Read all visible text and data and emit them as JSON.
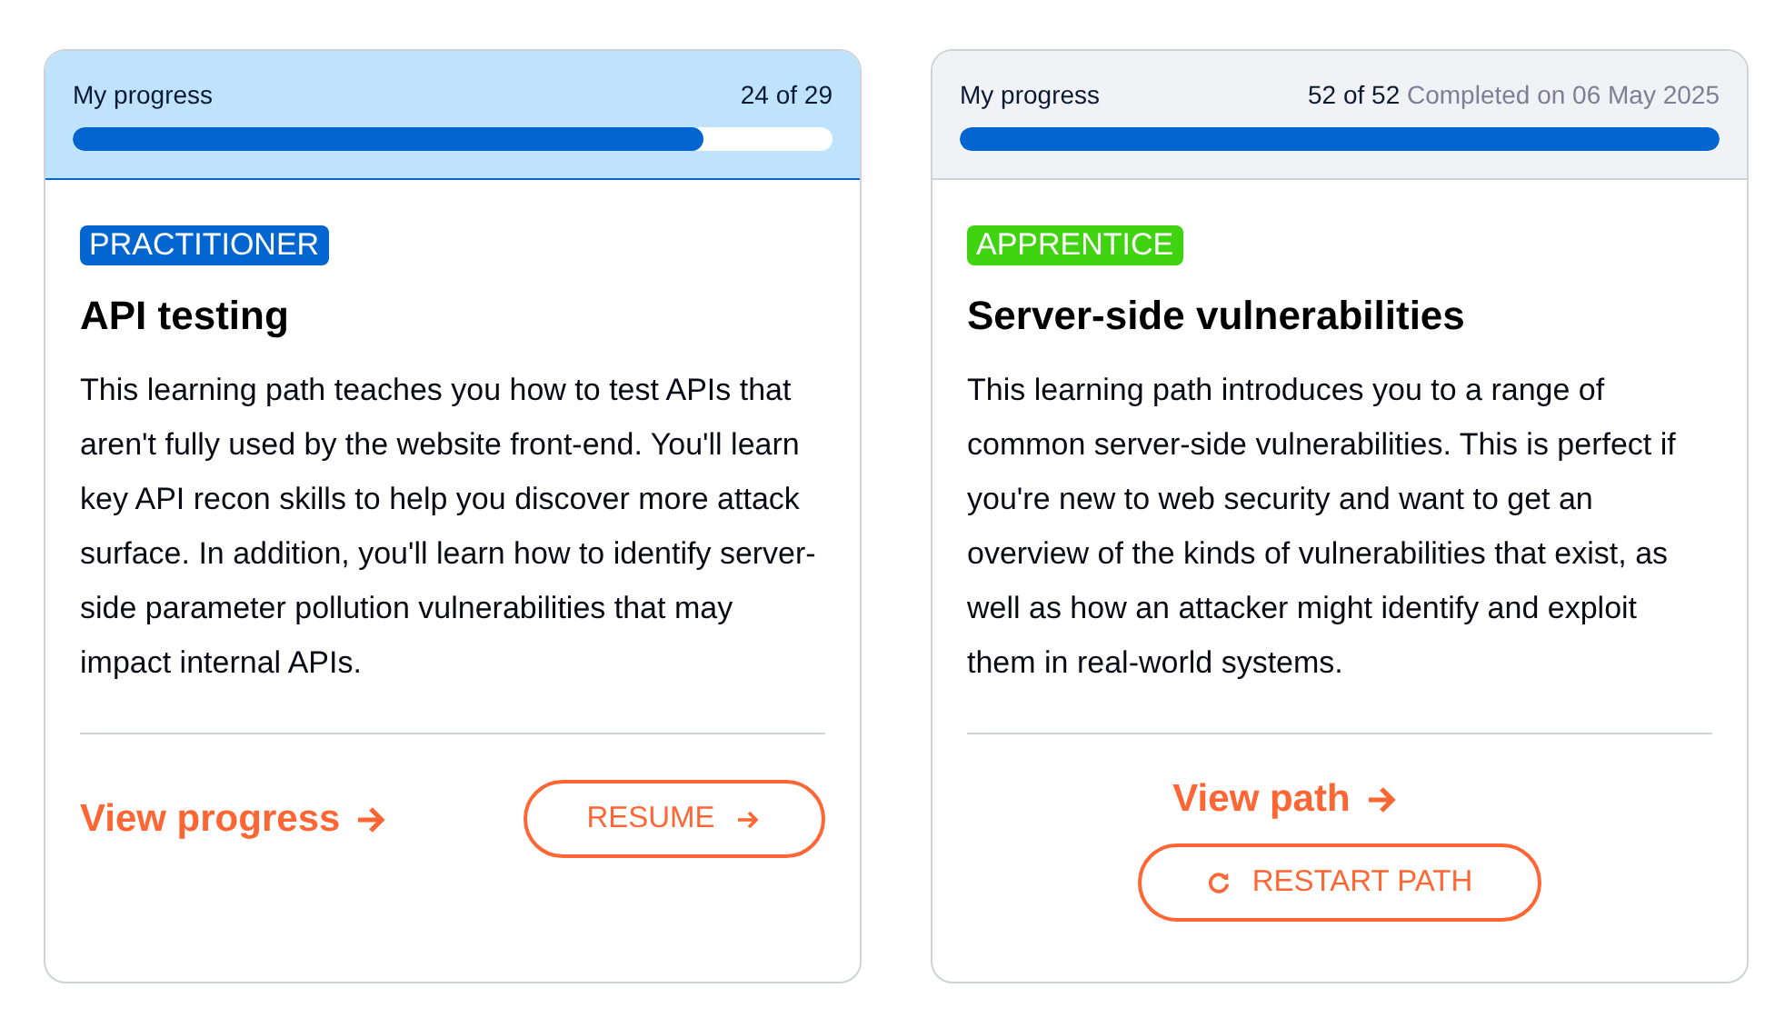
{
  "cards": [
    {
      "progress": {
        "label": "My progress",
        "count": "24 of 29",
        "completed": false,
        "level": 0.83
      },
      "badge": {
        "label": "PRACTITIONER",
        "color": "#0366d0"
      },
      "title": "API testing",
      "description": "This learning path teaches you how to test APIs that aren't fully used by the website front-end. You'll learn key API recon skills to help you discover more attack surface. In addition, you'll learn how to identify server-side parameter pollution vulnerabilities that may impact internal APIs.",
      "link": "View progress",
      "button": {
        "kind": "resume",
        "label": "RESUME"
      }
    },
    {
      "progress": {
        "label": "My progress",
        "count": "52 of 52",
        "completed": true,
        "completed_note": "Completed on 06 May 2025",
        "level": 1
      },
      "badge": {
        "label": "APPRENTICE",
        "color": "#3fd40f"
      },
      "title": "Server-side vulnerabilities",
      "description": "This learning path introduces you to a range of common server-side vulnerabilities. This is perfect if you're new to web security and want to get an overview of the kinds of vulnerabilities that exist, as well as how an attacker might identify and exploit them in real-world systems.",
      "link": "View path",
      "button": {
        "kind": "restart",
        "label": "RESTART PATH"
      }
    }
  ]
}
